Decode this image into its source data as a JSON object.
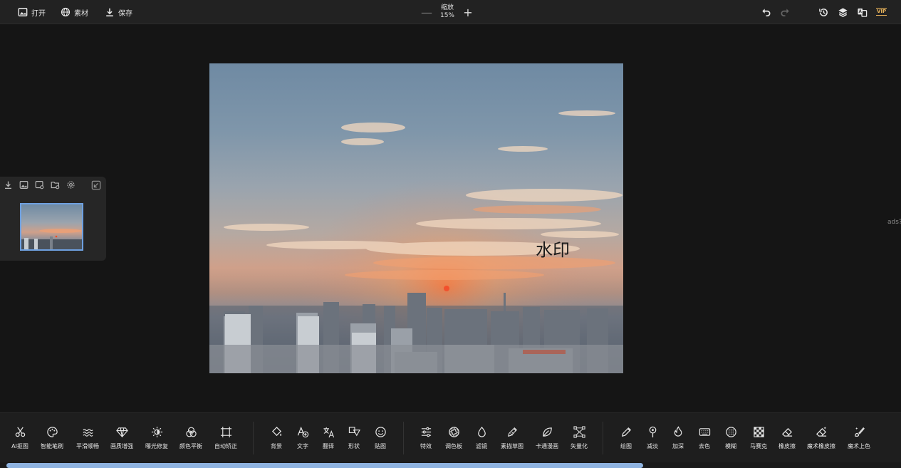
{
  "header": {
    "open_label": "打开",
    "material_label": "素材",
    "save_label": "保存",
    "zoom_label": "缩放",
    "zoom_value": "15%",
    "zoom_minus": "—",
    "zoom_plus": "+",
    "vip_label": "VIP",
    "right_icons": [
      "undo-icon",
      "redo-icon",
      "history-icon",
      "layers-icon",
      "translate-icon"
    ]
  },
  "canvas": {
    "watermark_text": "水印",
    "edge_text": "ads?"
  },
  "side_panel": {
    "icons": [
      "download-icon",
      "image-icon",
      "image-settings-icon",
      "folder-settings-icon",
      "gear-icon"
    ],
    "collapse_icon": "collapse-icon"
  },
  "toolbar": {
    "group1": [
      {
        "label": "AI抠图",
        "icon": "scissors-icon"
      },
      {
        "label": "智能笔刷",
        "icon": "palette-icon"
      },
      {
        "label": "平滑顺畅",
        "icon": "waves-icon"
      },
      {
        "label": "画质增强",
        "icon": "diamond-icon"
      },
      {
        "label": "曝光修复",
        "icon": "sun-icon"
      },
      {
        "label": "颜色平衡",
        "icon": "circles-icon"
      },
      {
        "label": "自动矫正",
        "icon": "crop-icon"
      }
    ],
    "group2": [
      {
        "label": "背景",
        "icon": "paint-bucket-icon"
      },
      {
        "label": "文字",
        "icon": "text-add-icon"
      },
      {
        "label": "翻译",
        "icon": "translate-icon"
      },
      {
        "label": "形状",
        "icon": "shapes-icon"
      },
      {
        "label": "贴图",
        "icon": "smile-icon"
      }
    ],
    "group3": [
      {
        "label": "特效",
        "icon": "sliders-icon"
      },
      {
        "label": "调色板",
        "icon": "aperture-icon"
      },
      {
        "label": "滤镜",
        "icon": "drop-icon"
      },
      {
        "label": "素描草图",
        "icon": "sketch-icon"
      },
      {
        "label": "卡通漫画",
        "icon": "leaf-icon"
      },
      {
        "label": "矢量化",
        "icon": "vector-icon"
      }
    ],
    "group4": [
      {
        "label": "绘图",
        "icon": "pencil-icon"
      },
      {
        "label": "减淡",
        "icon": "dodge-icon"
      },
      {
        "label": "加深",
        "icon": "burn-icon"
      },
      {
        "label": "去色",
        "icon": "keyboard-icon"
      },
      {
        "label": "模糊",
        "icon": "blur-icon"
      },
      {
        "label": "马赛克",
        "icon": "mosaic-icon"
      },
      {
        "label": "橡皮擦",
        "icon": "eraser-icon"
      },
      {
        "label": "魔术橡皮擦",
        "icon": "magic-eraser-icon"
      },
      {
        "label": "魔术上色",
        "icon": "magic-brush-icon"
      }
    ]
  },
  "colors": {
    "background": "#151515",
    "topbar": "#222222",
    "toolbar": "#1e1e1e",
    "accent": "#6ea0e0",
    "vip": "#e8b35a"
  }
}
